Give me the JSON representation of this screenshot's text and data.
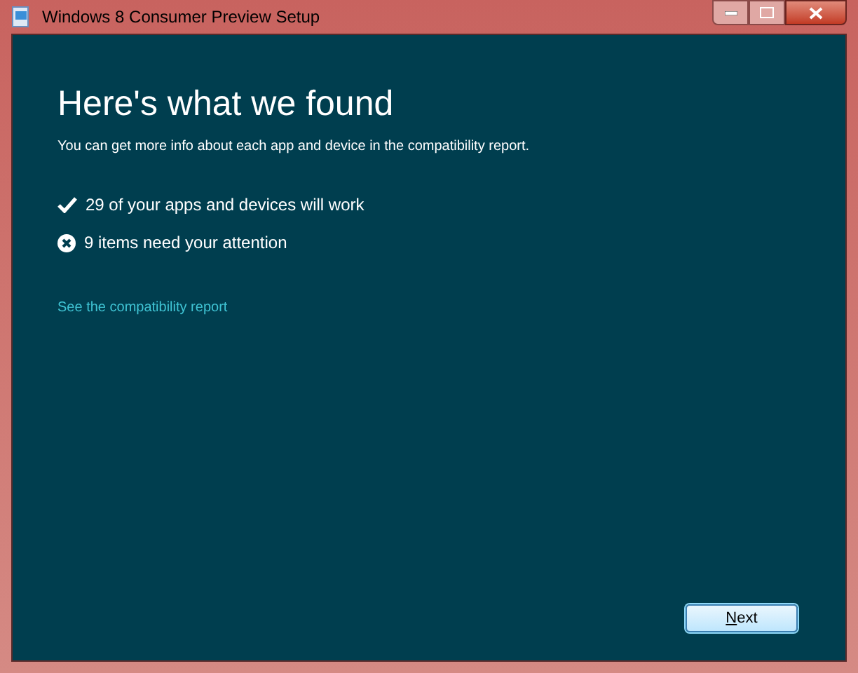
{
  "window": {
    "title": "Windows 8 Consumer Preview Setup"
  },
  "heading": "Here's what we found",
  "subtitle": "You can get more info about each app and device in the compatibility report.",
  "results": [
    {
      "kind": "ok",
      "text": "29 of your apps and devices will work"
    },
    {
      "kind": "attention",
      "text": "9 items need your attention"
    }
  ],
  "link": "See the compatibility report",
  "buttons": [
    {
      "label": "Next"
    }
  ]
}
